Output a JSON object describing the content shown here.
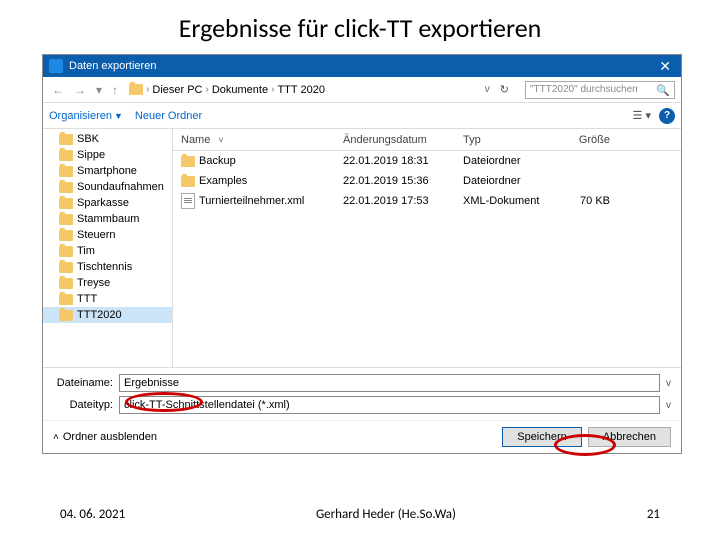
{
  "slide_title": "Ergebnisse für click-TT exportieren",
  "dialog": {
    "title": "Daten exportieren",
    "nav": {
      "back": "←",
      "forward": "→",
      "up": "↑",
      "crumbs": [
        "Dieser PC",
        "Dokumente",
        "TTT 2020"
      ],
      "refresh": "↻"
    },
    "search_placeholder": "\"TTT2020\" durchsuchen",
    "toolbar": {
      "organize": "Organisieren",
      "new_folder": "Neuer Ordner"
    },
    "sidebar": {
      "items": [
        "SBK",
        "Sippe",
        "Smartphone",
        "Soundaufnahmen",
        "Sparkasse",
        "Stammbaum",
        "Steuern",
        "Tim",
        "Tischtennis",
        "Treyse",
        "TTT",
        "TTT2020"
      ]
    },
    "columns": {
      "name": "Name",
      "date": "Änderungsdatum",
      "type": "Typ",
      "size": "Größe"
    },
    "files": [
      {
        "name": "Backup",
        "date": "22.01.2019 18:31",
        "type": "Dateiordner",
        "size": "",
        "kind": "folder"
      },
      {
        "name": "Examples",
        "date": "22.01.2019 15:36",
        "type": "Dateiordner",
        "size": "",
        "kind": "folder"
      },
      {
        "name": "Turnierteilnehmer.xml",
        "date": "22.01.2019 17:53",
        "type": "XML-Dokument",
        "size": "70 KB",
        "kind": "file"
      }
    ],
    "filename_label": "Dateiname:",
    "filename_value": "Ergebnisse",
    "filetype_label": "Dateityp:",
    "filetype_value": "click-TT-Schnittstellendatei (*.xml)",
    "hide_folders": "Ordner ausblenden",
    "save_btn": "Speichern",
    "cancel_btn": "Abbrechen"
  },
  "footer": {
    "date": "04. 06. 2021",
    "author": "Gerhard Heder (He.So.Wa)",
    "page": "21"
  }
}
